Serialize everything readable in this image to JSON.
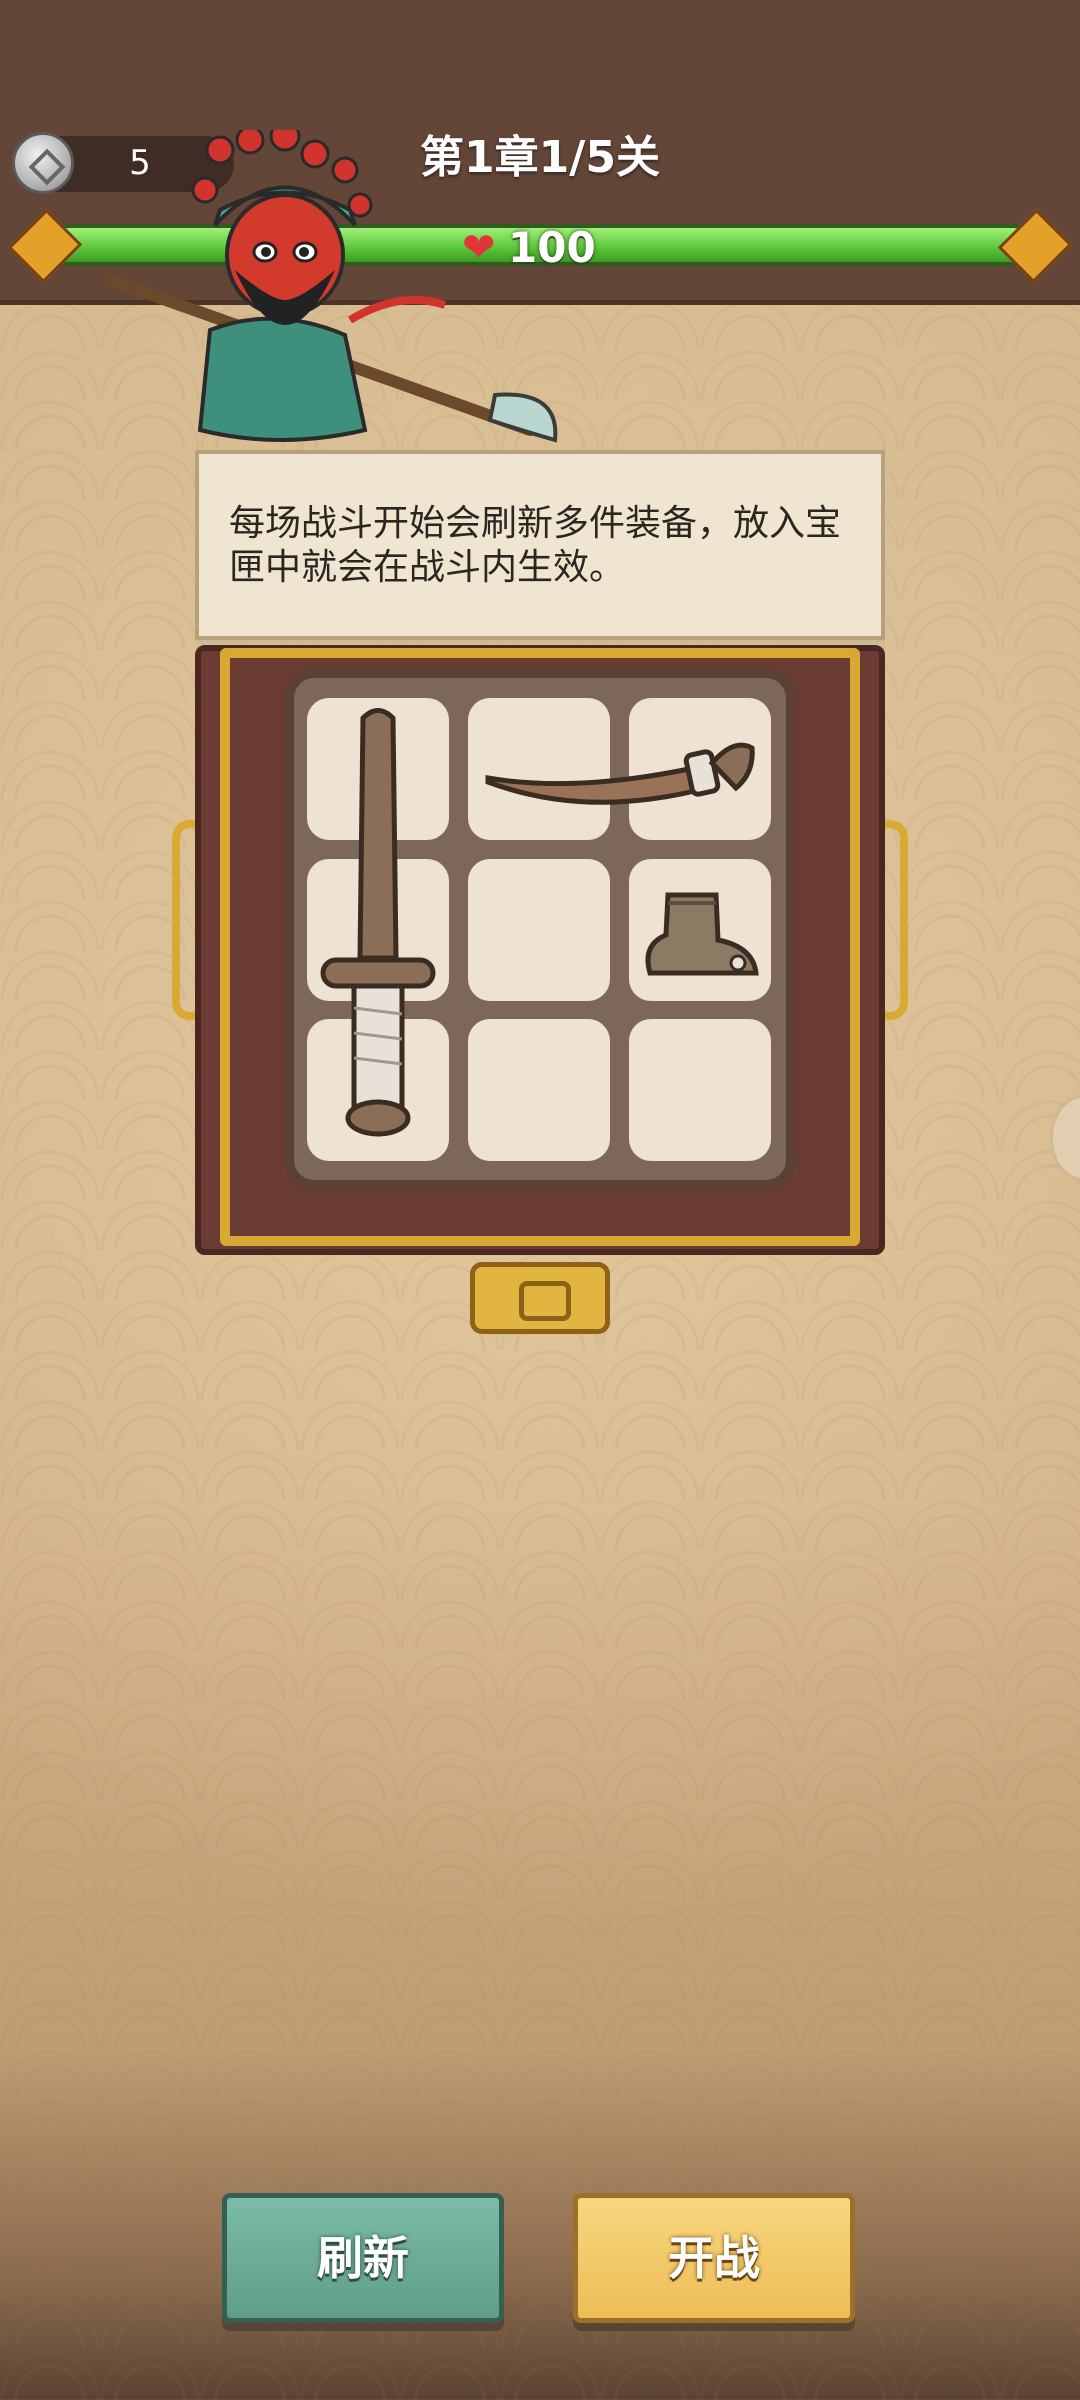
{
  "header": {
    "coins": "5",
    "level_title": "第1章1/5关",
    "hp": "100"
  },
  "tooltip": {
    "text": "每场战斗开始会刷新多件装备，放入宝匣中就会在战斗内生效。"
  },
  "chest": {
    "grid": "3x3",
    "items": [
      "wooden-sword",
      "wooden-saber",
      "cloth-boot"
    ]
  },
  "buttons": {
    "refresh": "刷新",
    "start": "开战"
  },
  "colors": {
    "topbar": "#634638",
    "hp_bar": "#5fc93c",
    "refresh_button": "#6aaa95",
    "start_button": "#f0c663"
  }
}
